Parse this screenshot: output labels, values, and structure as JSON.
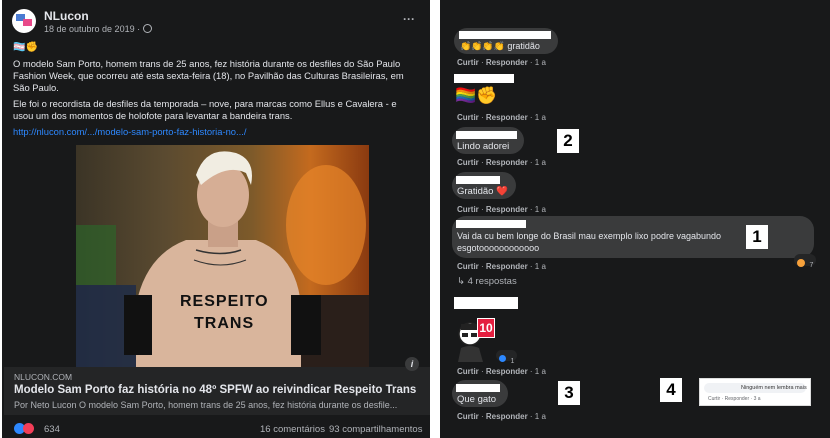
{
  "post": {
    "page_name": "NLucon",
    "date": "18 de outubro de 2019 · ",
    "globe_icon": "globe-icon",
    "flag_emojis": "🏳️‍⚧️✊",
    "paragraph1": "O modelo Sam Porto, homem trans de 25 anos, fez história durante os desfiles do São Paulo Fashion Week, que ocorreu até esta sexta-feira (18), no Pavilhão das Culturas Brasileiras, em São Paulo.",
    "paragraph2": "Ele foi o recordista de desfiles da temporada – nove, para marcas como Ellus e Cavalera - e usou um dos momentos de holofote para levantar a bandeira trans.",
    "link": "http://nlucon.com/.../modelo-sam-porto-faz-historia-no.../",
    "image_text_line1": "RESPEITO",
    "image_text_line2": "TRANS",
    "link_domain": "NLUCON.COM",
    "link_title": "Modelo Sam Porto faz história no 48º SPFW ao reivindicar Respeito Trans",
    "link_desc": "Por Neto Lucon O modelo Sam Porto, homem trans de 25 anos, fez história durante os desfile...",
    "reactions_count": "634",
    "comments_count": "16 comentários",
    "shares_count": "93 compartilhamentos",
    "more_menu": "···"
  },
  "comments": {
    "c1_text": "👏👏👏👏 gratidão",
    "c2_emojis": "🏳️‍🌈✊",
    "c3_text": "Lindo adorei",
    "c4_text": "Gratidão ❤️",
    "c5_text_line1": "Vai da cu bem longe do Brasil mau exemplo lixo podre vagabundo",
    "c5_text_line2": "esgotoooooooooooo",
    "c5_reaction_count": "7",
    "c5_replies": "4 respostas",
    "c6_sticker_number": "10",
    "c6_reaction_count": "1",
    "c7_text": "Que gato",
    "like_label": "Curtir",
    "reply_label": "Responder",
    "dot": "·",
    "time": "1 a",
    "inset_text": "Ninguém nem lembra mais",
    "inset_actions": "Curtir · Responder · 3 a"
  },
  "badges": {
    "b1": "1",
    "b2": "2",
    "b3": "3",
    "b4": "4"
  },
  "colors": {
    "panel_bg": "#18191a",
    "bubble_bg": "#3a3b3c",
    "link_blue": "#2d88ff",
    "badge_red": "#e41e3f"
  }
}
